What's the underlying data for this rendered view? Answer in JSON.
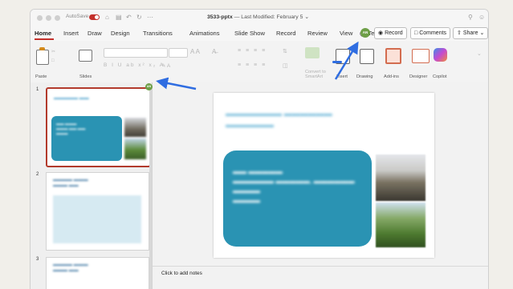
{
  "titlebar": {
    "autosave_label": "AutoSave",
    "document_title": "3533-pptx",
    "document_subtitle": " — Last Modified: February 5 ⌄"
  },
  "tabs": [
    "Home",
    "Insert",
    "Draw",
    "Design",
    "Transitions",
    "Animations",
    "Slide Show",
    "Record",
    "Review",
    "View"
  ],
  "tell_me": "Tell me",
  "avatar_initials": "AN",
  "record_label": "Record",
  "comments_label": "Comments",
  "share_label": "Share",
  "toolbar": {
    "paste": "Paste",
    "slides": "Slides",
    "convert_smartart": "Convert to SmartArt",
    "insert": "Insert",
    "drawing": "Drawing",
    "add_ins": "Add-ins",
    "designer": "Designer",
    "copilot": "Copilot"
  },
  "slides": [
    {
      "number": "1"
    },
    {
      "number": "2"
    },
    {
      "number": "3"
    }
  ],
  "notes_placeholder": "Click to add notes",
  "colors": {
    "accent": "#c4302b",
    "card": "#2a93b3",
    "arrow": "#2f6de1",
    "avatar": "#6e9f47"
  }
}
